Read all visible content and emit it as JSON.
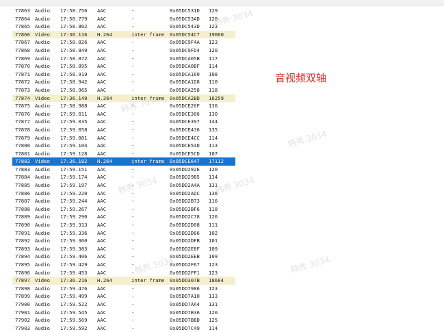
{
  "annotation": "音视频双轴",
  "watermark": "韩秀 3034",
  "rows": [
    {
      "num": "77863",
      "type": "Audio",
      "time": "17:58.756",
      "codec": "AAC",
      "frame": "-",
      "offset": "0x05DC531D",
      "size": "129"
    },
    {
      "num": "77864",
      "type": "Audio",
      "time": "17:58.779",
      "codec": "AAC",
      "frame": "-",
      "offset": "0x05DC53AD",
      "size": "120"
    },
    {
      "num": "77865",
      "type": "Audio",
      "time": "17:58.802",
      "codec": "AAC",
      "frame": "-",
      "offset": "0x05DC543D",
      "size": "123"
    },
    {
      "num": "77866",
      "type": "Video",
      "time": "17:36.116",
      "codec": "H.264",
      "frame": "inter frame",
      "offset": "0x05DC54C7",
      "size": "19060"
    },
    {
      "num": "77867",
      "type": "Audio",
      "time": "17:58.826",
      "codec": "AAC",
      "frame": "-",
      "offset": "0x05DC9F4A",
      "size": "123"
    },
    {
      "num": "77868",
      "type": "Audio",
      "time": "17:58.849",
      "codec": "AAC",
      "frame": "-",
      "offset": "0x05DC9FD4",
      "size": "120"
    },
    {
      "num": "77869",
      "type": "Audio",
      "time": "17:58.872",
      "codec": "AAC",
      "frame": "-",
      "offset": "0x05DCA05B",
      "size": "117"
    },
    {
      "num": "77870",
      "type": "Audio",
      "time": "17:58.895",
      "codec": "AAC",
      "frame": "-",
      "offset": "0x05DCA0BF",
      "size": "114"
    },
    {
      "num": "77871",
      "type": "Audio",
      "time": "17:58.919",
      "codec": "AAC",
      "frame": "-",
      "offset": "0x05DCA160",
      "size": "108"
    },
    {
      "num": "77872",
      "type": "Audio",
      "time": "17:58.942",
      "codec": "AAC",
      "frame": "-",
      "offset": "0x05DCA1D8",
      "size": "110"
    },
    {
      "num": "77873",
      "type": "Audio",
      "time": "17:58.965",
      "codec": "AAC",
      "frame": "-",
      "offset": "0x05DCA258",
      "size": "118"
    },
    {
      "num": "77874",
      "type": "Video",
      "time": "17:36.149",
      "codec": "H.264",
      "frame": "inter frame",
      "offset": "0x05DCA2BD",
      "size": "16259"
    },
    {
      "num": "77875",
      "type": "Audio",
      "time": "17:58.988",
      "codec": "AAC",
      "frame": "-",
      "offset": "0x05DCE26F",
      "size": "136"
    },
    {
      "num": "77876",
      "type": "Audio",
      "time": "17:59.011",
      "codec": "AAC",
      "frame": "-",
      "offset": "0x05DCE306",
      "size": "130"
    },
    {
      "num": "77877",
      "type": "Audio",
      "time": "17:59.035",
      "codec": "AAC",
      "frame": "-",
      "offset": "0x05DCE397",
      "size": "144"
    },
    {
      "num": "77878",
      "type": "Audio",
      "time": "17:59.058",
      "codec": "AAC",
      "frame": "-",
      "offset": "0x05DCE436",
      "size": "135"
    },
    {
      "num": "77879",
      "type": "Audio",
      "time": "17:59.081",
      "codec": "AAC",
      "frame": "-",
      "offset": "0x05DCE4CC",
      "size": "114"
    },
    {
      "num": "77880",
      "type": "Audio",
      "time": "17:59.104",
      "codec": "AAC",
      "frame": "-",
      "offset": "0x05DCE54D",
      "size": "113"
    },
    {
      "num": "77881",
      "type": "Audio",
      "time": "17:59.128",
      "codec": "AAC",
      "frame": "-",
      "offset": "0x05DCE5CD",
      "size": "107"
    },
    {
      "num": "77882",
      "type": "Video",
      "time": "17:36.182",
      "codec": "H.264",
      "frame": "inter frame",
      "offset": "0x05DCE647",
      "size": "17112"
    },
    {
      "num": "77883",
      "type": "Audio",
      "time": "17:59.151",
      "codec": "AAC",
      "frame": "-",
      "offset": "0x05DD292E",
      "size": "120"
    },
    {
      "num": "77884",
      "type": "Audio",
      "time": "17:59.174",
      "codec": "AAC",
      "frame": "-",
      "offset": "0x05DD29B5",
      "size": "134"
    },
    {
      "num": "77885",
      "type": "Audio",
      "time": "17:59.197",
      "codec": "AAC",
      "frame": "-",
      "offset": "0x05DD2A4A",
      "size": "131"
    },
    {
      "num": "77886",
      "type": "Audio",
      "time": "17:59.220",
      "codec": "AAC",
      "frame": "-",
      "offset": "0x05DD2ADC",
      "size": "136"
    },
    {
      "num": "77887",
      "type": "Audio",
      "time": "17:59.244",
      "codec": "AAC",
      "frame": "-",
      "offset": "0x05DD2B73",
      "size": "116"
    },
    {
      "num": "77888",
      "type": "Audio",
      "time": "17:59.267",
      "codec": "AAC",
      "frame": "-",
      "offset": "0x05DD2BF6",
      "size": "118"
    },
    {
      "num": "77889",
      "type": "Audio",
      "time": "17:59.290",
      "codec": "AAC",
      "frame": "-",
      "offset": "0x05DD2C78",
      "size": "126"
    },
    {
      "num": "77890",
      "type": "Audio",
      "time": "17:59.313",
      "codec": "AAC",
      "frame": "-",
      "offset": "0x05DD2D08",
      "size": "111"
    },
    {
      "num": "77891",
      "type": "Audio",
      "time": "17:59.336",
      "codec": "AAC",
      "frame": "-",
      "offset": "0x05DD2D86",
      "size": "102"
    },
    {
      "num": "77892",
      "type": "Audio",
      "time": "17:59.360",
      "codec": "AAC",
      "frame": "-",
      "offset": "0x05DD2DFB",
      "size": "101"
    },
    {
      "num": "77893",
      "type": "Audio",
      "time": "17:59.383",
      "codec": "AAC",
      "frame": "-",
      "offset": "0x05DD2E8F",
      "size": "109"
    },
    {
      "num": "77894",
      "type": "Audio",
      "time": "17:59.406",
      "codec": "AAC",
      "frame": "-",
      "offset": "0x05DD2EEB",
      "size": "109"
    },
    {
      "num": "77895",
      "type": "Audio",
      "time": "17:59.429",
      "codec": "AAC",
      "frame": "-",
      "offset": "0x05DD2F67",
      "size": "123"
    },
    {
      "num": "77896",
      "type": "Audio",
      "time": "17:59.453",
      "codec": "AAC",
      "frame": "-",
      "offset": "0x05DD2FF1",
      "size": "123"
    },
    {
      "num": "77897",
      "type": "Video",
      "time": "17:36.216",
      "codec": "H.264",
      "frame": "inter frame",
      "offset": "0x05DD307B",
      "size": "18684"
    },
    {
      "num": "77898",
      "type": "Audio",
      "time": "17:59.476",
      "codec": "AAC",
      "frame": "-",
      "offset": "0x05DD7986",
      "size": "123"
    },
    {
      "num": "77899",
      "type": "Audio",
      "time": "17:59.499",
      "codec": "AAC",
      "frame": "-",
      "offset": "0x05DD7A10",
      "size": "133"
    },
    {
      "num": "77900",
      "type": "Audio",
      "time": "17:59.522",
      "codec": "AAC",
      "frame": "-",
      "offset": "0x05DD7AA4",
      "size": "131"
    },
    {
      "num": "77901",
      "type": "Audio",
      "time": "17:59.545",
      "codec": "AAC",
      "frame": "-",
      "offset": "0x05DD7B36",
      "size": "120"
    },
    {
      "num": "77902",
      "type": "Audio",
      "time": "17:59.569",
      "codec": "AAC",
      "frame": "-",
      "offset": "0x05DD7BBD",
      "size": "125"
    },
    {
      "num": "77903",
      "type": "Audio",
      "time": "17:59.592",
      "codec": "AAC",
      "frame": "-",
      "offset": "0x05DD7C49",
      "size": "114"
    }
  ],
  "selected_num": "77882",
  "colors": {
    "video_row": "#f6efcf",
    "selected_row": "#1874d1",
    "annotation": "#e0332b"
  }
}
